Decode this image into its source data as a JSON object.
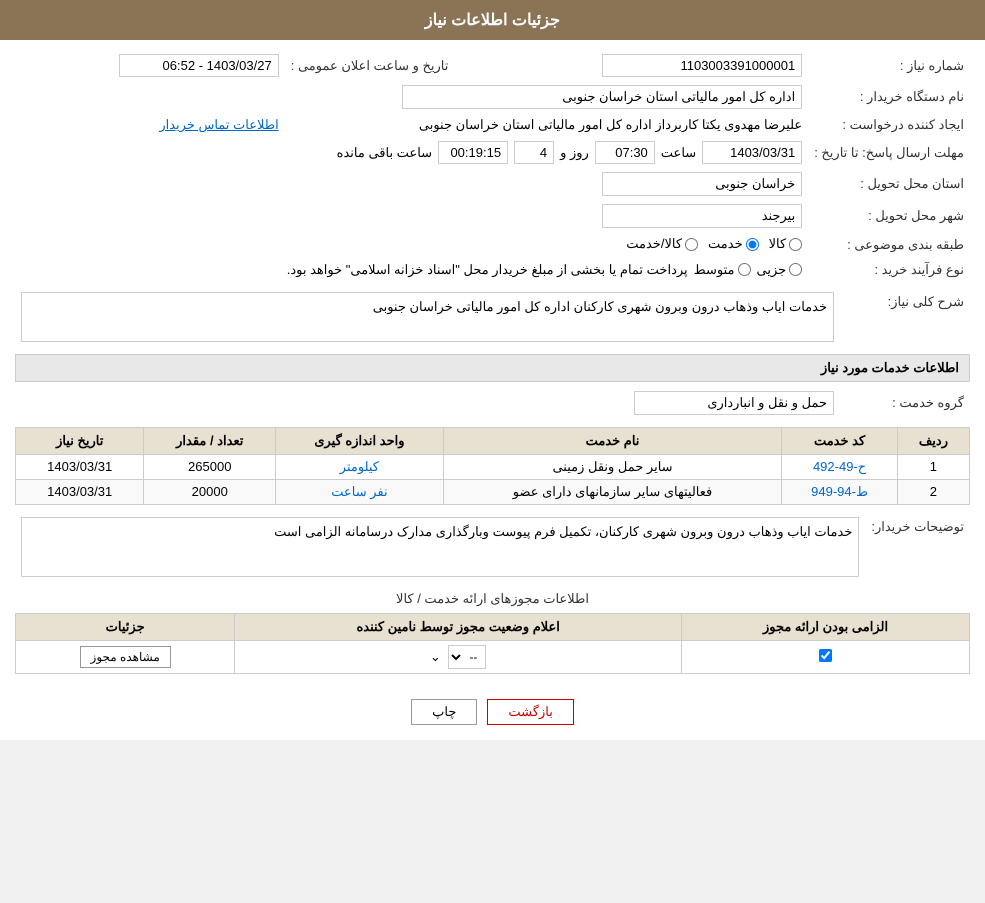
{
  "header": {
    "title": "جزئیات اطلاعات نیاز"
  },
  "main_info": {
    "shomara_niaz_label": "شماره نیاز :",
    "shomara_niaz_value": "1103003391000001",
    "name_dastgah_label": "نام دستگاه خریدار :",
    "name_dastgah_value": "اداره کل امور مالیاتی استان خراسان جنوبی",
    "tarikh_ealaan_label": "تاریخ و ساعت اعلان عمومی :",
    "tarikh_ealaan_value": "1403/03/27 - 06:52",
    "ijan_label": "ایجاد کننده درخواست :",
    "ijan_value": "علیرضا مهدوی یکتا کاربرداز اداره کل امور مالیاتی استان خراسان جنوبی",
    "ettelaat_tamas_label": "اطلاعات تماس خریدار",
    "mohlat_label": "مهلت ارسال پاسخ: تا تاریخ :",
    "mohlat_date": "1403/03/31",
    "mohlat_saat_label": "ساعت",
    "mohlat_saat_value": "07:30",
    "mohlat_roz_label": "روز و",
    "mohlat_roz_value": "4",
    "mohlat_baqi_label": "ساعت باقی مانده",
    "mohlat_baqi_value": "00:19:15",
    "ostan_tahvil_label": "استان محل تحویل :",
    "ostan_tahvil_value": "خراسان جنوبی",
    "shahr_tahvil_label": "شهر محل تحویل :",
    "shahr_tahvil_value": "بیرجند",
    "tabaqe_label": "طبقه بندی موضوعی :",
    "radio_kala": "کالا",
    "radio_khedmat": "خدمت",
    "radio_kala_khedmat": "کالا/خدمت",
    "radio_selected": "khedmat",
    "nooe_farayand_label": "نوع فرآیند خرید :",
    "radio_jozi": "جزیی",
    "radio_mottavaset": "متوسط",
    "nooe_farayand_note": "پرداخت تمام یا بخشی از مبلغ خریدار محل \"اسناد خزانه اسلامی\" خواهد بود.",
    "sharh_koli_label": "شرح کلی نیاز:",
    "sharh_koli_value": "خدمات ایاب وذهاب درون وبرون شهری کارکنان اداره کل امور مالیاتی خراسان جنوبی",
    "info_khadamat_title": "اطلاعات خدمات مورد نیاز",
    "goroh_khedmat_label": "گروه خدمت :",
    "goroh_khedmat_value": "حمل و نقل و انبارداری"
  },
  "services_table": {
    "headers": [
      "ردیف",
      "کد خدمت",
      "نام خدمت",
      "واحد اندازه گیری",
      "تعداد / مقدار",
      "تاریخ نیاز"
    ],
    "rows": [
      {
        "radif": "1",
        "kod": "ح-49-492",
        "naam": "سایر حمل ونقل زمینی",
        "vahed": "کیلومتر",
        "tedad": "265000",
        "tarikh": "1403/03/31"
      },
      {
        "radif": "2",
        "kod": "ط-94-949",
        "naam": "فعالیتهای سایر سازمانهای دارای عضو",
        "vahed": "نفر ساعت",
        "tedad": "20000",
        "tarikh": "1403/03/31"
      }
    ]
  },
  "description": {
    "label": "توضیحات خریدار:",
    "value": "خدمات ایاب وذهاب درون وبرون شهری کارکنان، تکمیل فرم پیوست وبارگذاری مدارک درسامانه الزامی است"
  },
  "permissions_section": {
    "title": "اطلاعات مجوزهای ارائه خدمت / کالا",
    "table_headers": [
      "الزامی بودن ارائه مجوز",
      "اعلام وضعیت مجوز توسط نامین کننده",
      "جزئیات"
    ],
    "rows": [
      {
        "elzami": true,
        "ealam_value": "--",
        "joziyat_btn": "مشاهده مجوز"
      }
    ]
  },
  "footer": {
    "print_label": "چاپ",
    "back_label": "بازگشت"
  }
}
